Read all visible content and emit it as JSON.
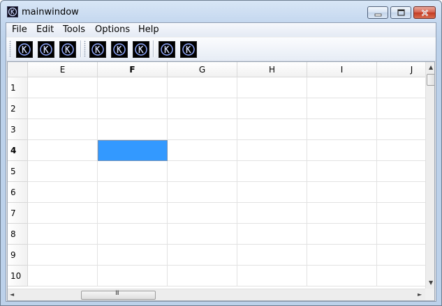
{
  "window": {
    "title": "mainwindow",
    "title_color": "#000000",
    "frame_color": "#c5d8ef"
  },
  "menubar": {
    "items": [
      {
        "label": "File"
      },
      {
        "label": "Edit"
      },
      {
        "label": "Tools"
      },
      {
        "label": "Options"
      },
      {
        "label": "Help"
      }
    ]
  },
  "toolbar": {
    "groups": [
      {
        "buttons": [
          {
            "icon": "k-logo-icon"
          },
          {
            "icon": "k-logo-icon"
          },
          {
            "icon": "k-logo-icon"
          }
        ]
      },
      {
        "buttons": [
          {
            "icon": "k-logo-icon"
          },
          {
            "icon": "k-logo-icon"
          },
          {
            "icon": "k-logo-icon"
          }
        ]
      },
      {
        "buttons": [
          {
            "icon": "k-logo-icon"
          },
          {
            "icon": "k-logo-icon"
          }
        ]
      }
    ]
  },
  "sheet": {
    "columns": [
      "E",
      "F",
      "G",
      "H",
      "I",
      "J"
    ],
    "rows": [
      "1",
      "2",
      "3",
      "4",
      "5",
      "6",
      "7",
      "8",
      "9",
      "10"
    ],
    "active_column": "F",
    "active_row": "4",
    "selected_cell": "F4",
    "selection_color": "#3399ff",
    "hscroll_thumb_glyph": "III"
  },
  "scrollbars": {
    "up_arrow": "▲",
    "down_arrow": "▼",
    "left_arrow": "◄",
    "right_arrow": "►"
  }
}
